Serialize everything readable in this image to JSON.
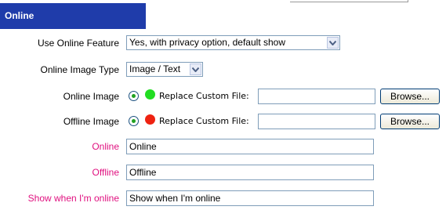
{
  "section": {
    "title": "Online"
  },
  "fields": {
    "use_online_feature": {
      "label": "Use Online Feature",
      "selected": "Yes, with privacy option, default show"
    },
    "online_image_type": {
      "label": "Online Image Type",
      "selected": "Image / Text"
    },
    "online_image": {
      "label": "Online Image",
      "replace_label": "Replace Custom File:",
      "browse_label": "Browse...",
      "dot_color": "#22dd22"
    },
    "offline_image": {
      "label": "Offline Image",
      "replace_label": "Replace Custom File:",
      "browse_label": "Browse...",
      "dot_color": "#ee2211"
    },
    "online_text": {
      "label": "Online",
      "value": "Online"
    },
    "offline_text": {
      "label": "Offline",
      "value": "Offline"
    },
    "show_when_online": {
      "label": "Show when I'm online",
      "value": "Show when I'm online"
    }
  },
  "colors": {
    "header_bg": "#1f3caa",
    "pink_label": "#e0107f"
  },
  "icons": {
    "dropdown": "chevron-down-icon",
    "radio": "radio-selected-icon",
    "online_status": "green-dot-icon",
    "offline_status": "red-dot-icon"
  }
}
